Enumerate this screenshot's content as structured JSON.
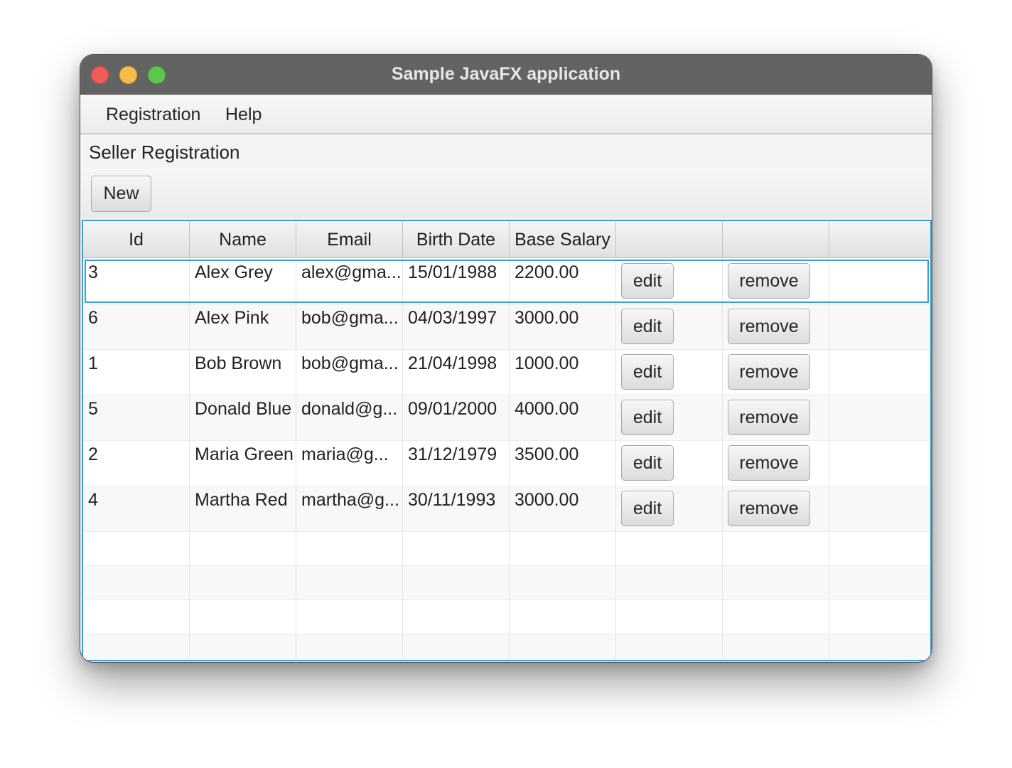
{
  "window": {
    "title": "Sample JavaFX application"
  },
  "menubar": {
    "items": [
      {
        "label": "Registration"
      },
      {
        "label": "Help"
      }
    ]
  },
  "main": {
    "heading": "Seller Registration",
    "new_button_label": "New"
  },
  "table": {
    "columns": [
      "Id",
      "Name",
      "Email",
      "Birth Date",
      "Base Salary",
      "",
      "",
      ""
    ],
    "rows": [
      {
        "id": "3",
        "name": "Alex Grey",
        "email": "alex@gma...",
        "birth_date": "15/01/1988",
        "base_salary": "2200.00",
        "edit": "edit",
        "remove": "remove"
      },
      {
        "id": "6",
        "name": "Alex Pink",
        "email": "bob@gma...",
        "birth_date": "04/03/1997",
        "base_salary": "3000.00",
        "edit": "edit",
        "remove": "remove"
      },
      {
        "id": "1",
        "name": "Bob Brown",
        "email": "bob@gma...",
        "birth_date": "21/04/1998",
        "base_salary": "1000.00",
        "edit": "edit",
        "remove": "remove"
      },
      {
        "id": "5",
        "name": "Donald Blue",
        "email": "donald@g...",
        "birth_date": "09/01/2000",
        "base_salary": "4000.00",
        "edit": "edit",
        "remove": "remove"
      },
      {
        "id": "2",
        "name": "Maria Green",
        "email": "maria@g...",
        "birth_date": "31/12/1979",
        "base_salary": "3500.00",
        "edit": "edit",
        "remove": "remove"
      },
      {
        "id": "4",
        "name": "Martha Red",
        "email": "martha@g...",
        "birth_date": "30/11/1993",
        "base_salary": "3000.00",
        "edit": "edit",
        "remove": "remove"
      }
    ],
    "selected_row": 0
  },
  "colors": {
    "titlebar": "#636363",
    "focus_accent": "#3b9fcf",
    "close": "#ee5c55",
    "minimize": "#f6be48",
    "maximize": "#5cc64f"
  }
}
